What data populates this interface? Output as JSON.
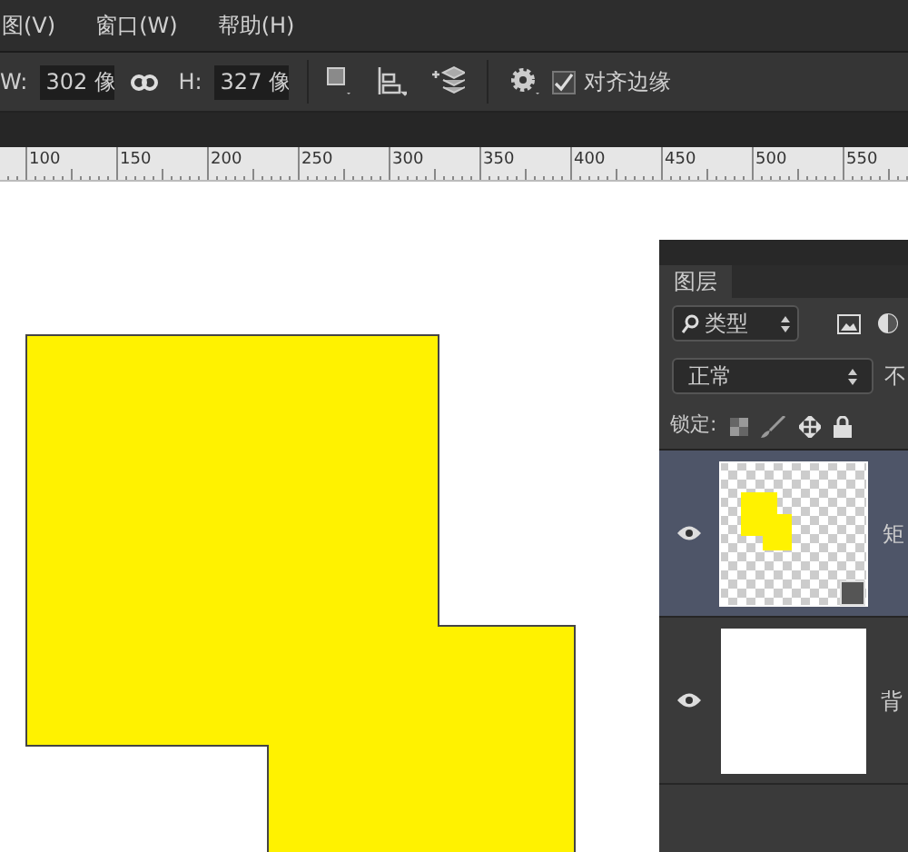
{
  "menu": [
    "图(V)",
    "窗口(W)",
    "帮助(H)"
  ],
  "options": {
    "width_label": "W:",
    "width": "302 像",
    "height_label": "H:",
    "height": "327 像",
    "align_edges": {
      "label": "对齐边缘",
      "checked": true
    }
  },
  "ruler": [
    "100",
    "150",
    "200",
    "250",
    "300",
    "350",
    "400",
    "450",
    "500",
    "550"
  ],
  "layers_panel": {
    "tab": "图层",
    "filter": "类型",
    "blend_mode": "正常",
    "opacity_label": "不",
    "lock_label": "锁定:",
    "layers": [
      {
        "name": "矩",
        "selected": true,
        "visible": true,
        "kind": "shape"
      },
      {
        "name": "背",
        "selected": false,
        "visible": true,
        "kind": "fill"
      }
    ]
  }
}
